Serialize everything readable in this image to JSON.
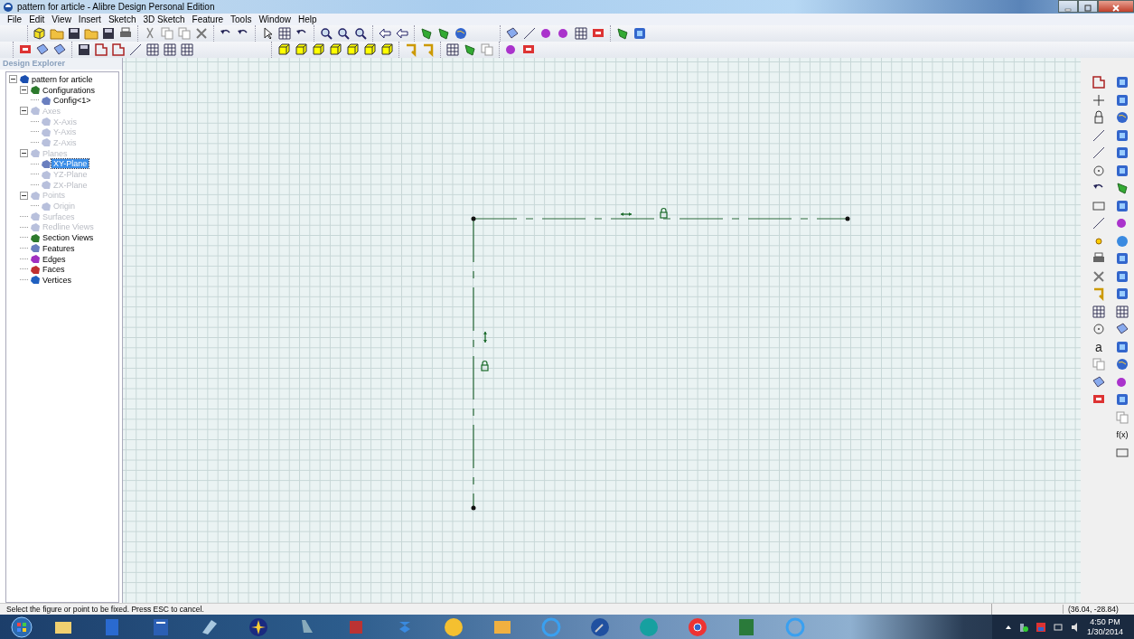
{
  "window": {
    "title": "pattern for article - Alibre Design Personal Edition"
  },
  "menu": [
    "File",
    "Edit",
    "View",
    "Insert",
    "Sketch",
    "3D Sketch",
    "Feature",
    "Tools",
    "Window",
    "Help"
  ],
  "explorer": {
    "title": "Design Explorer",
    "tree": [
      {
        "label": "pattern for article",
        "expanded": true,
        "disabled": false,
        "selected": false,
        "children": [
          {
            "label": "Configurations",
            "expanded": true,
            "disabled": false,
            "selected": false,
            "children": [
              {
                "label": "Config<1>",
                "disabled": false,
                "selected": false
              }
            ]
          },
          {
            "label": "Axes",
            "expanded": true,
            "disabled": true,
            "selected": false,
            "children": [
              {
                "label": "X-Axis",
                "disabled": true,
                "selected": false
              },
              {
                "label": "Y-Axis",
                "disabled": true,
                "selected": false
              },
              {
                "label": "Z-Axis",
                "disabled": true,
                "selected": false
              }
            ]
          },
          {
            "label": "Planes",
            "expanded": true,
            "disabled": true,
            "selected": false,
            "children": [
              {
                "label": "XY-Plane",
                "disabled": false,
                "selected": true
              },
              {
                "label": "YZ-Plane",
                "disabled": true,
                "selected": false
              },
              {
                "label": "ZX-Plane",
                "disabled": true,
                "selected": false
              }
            ]
          },
          {
            "label": "Points",
            "expanded": true,
            "disabled": true,
            "selected": false,
            "children": [
              {
                "label": "Origin",
                "disabled": true,
                "selected": false
              }
            ]
          },
          {
            "label": "Surfaces",
            "disabled": true,
            "selected": false
          },
          {
            "label": "Redline Views",
            "disabled": true,
            "selected": false
          },
          {
            "label": "Section Views",
            "disabled": false,
            "selected": false
          },
          {
            "label": "Features",
            "disabled": false,
            "selected": false
          },
          {
            "label": "Edges",
            "disabled": false,
            "selected": false
          },
          {
            "label": "Faces",
            "disabled": false,
            "selected": false
          },
          {
            "label": "Vertices",
            "disabled": false,
            "selected": false
          }
        ]
      }
    ]
  },
  "right_toolbar": {
    "text_tool": "a",
    "function_tool": "f(x)"
  },
  "status_bar": {
    "message": "Select the figure or point to be fixed. Press ESC to cancel.",
    "coordinates": "(36.04, -28.84)"
  },
  "taskbar": {
    "time": "4:50 PM",
    "date": "1/30/2014"
  }
}
